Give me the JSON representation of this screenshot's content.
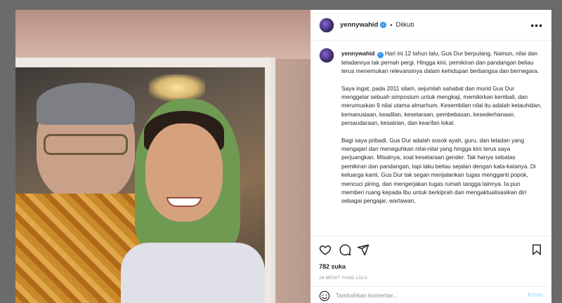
{
  "post": {
    "username": "yennywahid",
    "separator": "•",
    "follow_state": "Diikuti",
    "caption_paragraphs": [
      "Hari ini 12 tahun lalu, Gus Dur berpulang. Namun, nilai dan teladannya tak pernah pergi. Hingga kini, pemikiran dan pandangan beliau terus menemukan relevansinya dalam kehidupan berbangsa dan bernegara.",
      "Saya ingat, pada 2011 silam, sejumlah sahabat dan murid Gus Dur menggelar sebuah simposium untuk mengkaji, memikirkan kembali, dan merumuskan 9 nilai utama almarhum. Kesembilan nilai itu adalah ketauhidan, kemanusiaan, keadilan, kesetaraan, pembebasan, kesederhanaan, persaudaraan, kesatrian, dan kearifan lokal.",
      "Bagi saya pribadi, Gus Dur adalah sosok ayah, guru, dan teladan yang mengajari dan meneguhkan nilai-nilai yang hingga kini terus saya perjuangkan. Misalnya, soal kesetaraan gender. Tak hanya sebatas pemikiran dan pandangan, tapi laku beliau sejalan dengan kata-katanya. Di keluarga kami, Gus Dur tak segan menjalankan tugas mengganti popok, mencuci piring, dan mengerjakan tugas rumah tangga lainnya. Ia pun memberi ruang kepada Ibu untuk berkiprah dan mengaktualisasikan diri sebagai pengajar, wartawan,"
    ],
    "likes": "782 suka",
    "timestamp": "16 MENIT YANG LALU"
  },
  "comment": {
    "placeholder": "Tambahkan komentar...",
    "post_label": "Kirim"
  },
  "icons": {
    "more": "more-icon",
    "like": "heart-icon",
    "comment": "comment-icon",
    "share": "share-icon",
    "save": "bookmark-icon",
    "emoji": "emoji-icon"
  },
  "colors": {
    "verified": "#3897f0",
    "post_button": "#b2dffc",
    "muted_text": "#8e8e8e"
  }
}
